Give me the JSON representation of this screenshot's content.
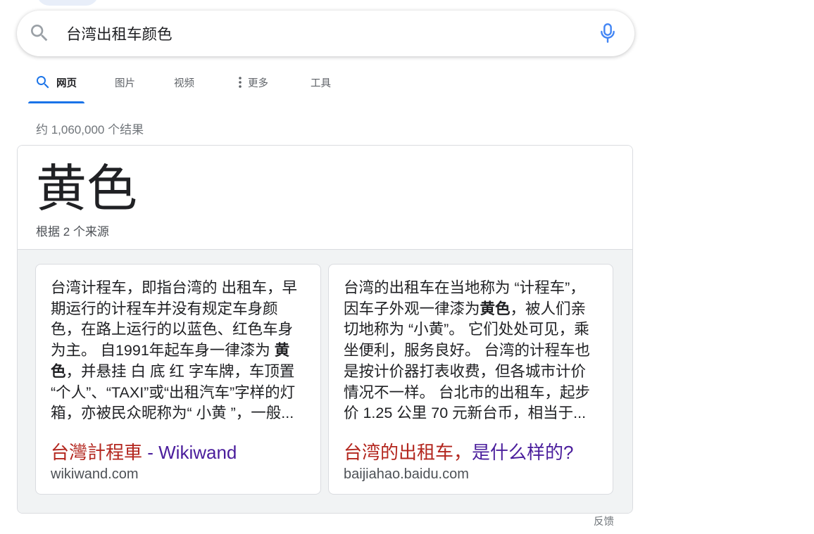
{
  "search": {
    "query": "台湾出租车颜色",
    "left_icon": "search-icon",
    "right_icon": "mic-icon"
  },
  "tabs": [
    {
      "label": "网页",
      "icon": "search-icon",
      "active": true
    },
    {
      "label": "图片"
    },
    {
      "label": "视频"
    },
    {
      "label": "更多",
      "icon": "more-vert-icon"
    },
    {
      "label": "工具"
    }
  ],
  "result_stats": "约 1,060,000 个结果",
  "answer": {
    "title": "黄色",
    "source_count": "根据 2 个来源",
    "sources": [
      {
        "snippet": [
          [
            "台湾计程车，即指台湾的 出租车，早"
          ],
          [
            "期运行的计程车并没有规定车身颜"
          ],
          [
            "色，在路上运行的以蓝色、红色车身"
          ],
          [
            "为主。 自1991年起车身一律漆为 ",
            "黄"
          ],
          [
            "色",
            "，并悬挂 白 底 红 字车牌，车顶置"
          ],
          [
            "“个人”、“TAXI”或“出租汽车”字样的灯"
          ],
          [
            "箱，亦被民众昵称为“ 小黄 ”，一般..."
          ]
        ],
        "title_parts": [
          "台灣計程車",
          " - Wikiwand"
        ],
        "domain": "wikiwand.com"
      },
      {
        "snippet": [
          [
            "台湾的出租车在当地称为 “计程车”，"
          ],
          [
            "因车子外观一律漆为",
            "黄色",
            "，被人们亲"
          ],
          [
            "切地称为 “小黄”。 它们处处可见，乘"
          ],
          [
            "坐便利，服务良好。 台湾的计程车也"
          ],
          [
            "是按计价器打表收费，但各城市计价"
          ],
          [
            "情况不一样。 台北市的出租车，起步"
          ],
          [
            "价 1.25 公里 70 元新台币，相当于..."
          ]
        ],
        "title_parts": [
          "台湾的出租车，",
          "是什么样的?"
        ],
        "domain": "baijiahao.baidu.com"
      }
    ]
  },
  "feedback_label": "反馈",
  "colors": {
    "accent": "#1a73e8",
    "text": "#202124",
    "secondary_text": "#70757a",
    "tab_text": "#5f6368",
    "body_text": "#4d5156",
    "link_match": "#b3261e",
    "link_visited": "#4a1d9c",
    "card_border": "#dadce0",
    "panel_background": "#f1f3f4",
    "chip_background": "#e8eef9",
    "icon_gray": "#9aa0a6",
    "mic_blue": "#4285f4"
  }
}
